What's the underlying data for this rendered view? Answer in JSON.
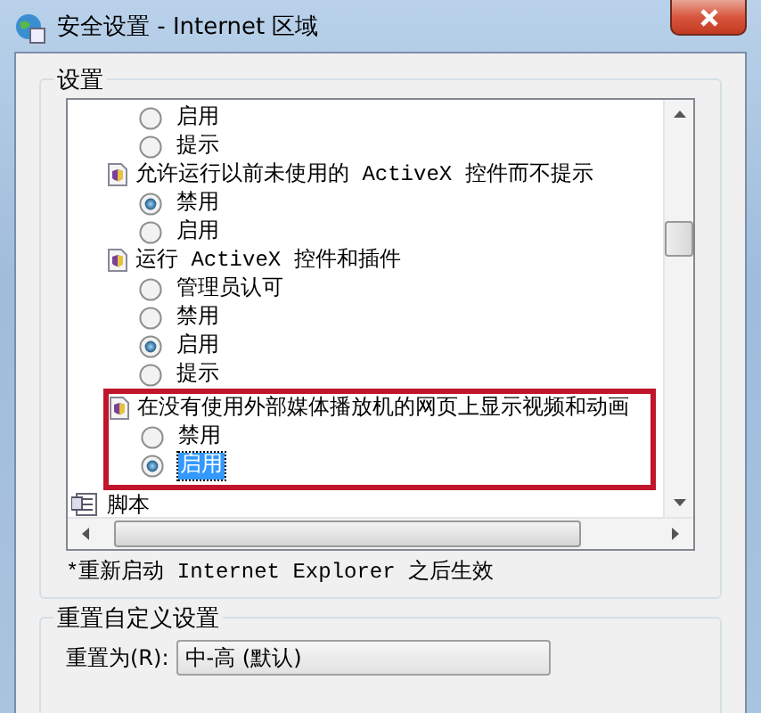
{
  "window": {
    "title": "安全设置 - Internet 区域"
  },
  "settings_group": {
    "title": "设置",
    "items": [
      {
        "options": [
          {
            "label": "启用",
            "selected": false,
            "focused": false
          },
          {
            "label": "提示",
            "selected": false,
            "focused": false
          }
        ],
        "highlighted": false
      },
      {
        "label": "允许运行以前未使用的 ActiveX 控件而不提示",
        "options": [
          {
            "label": "禁用",
            "selected": true,
            "focused": false
          },
          {
            "label": "启用",
            "selected": false,
            "focused": false
          }
        ],
        "highlighted": false
      },
      {
        "label": "运行 ActiveX 控件和插件",
        "options": [
          {
            "label": "管理员认可",
            "selected": false,
            "focused": false
          },
          {
            "label": "禁用",
            "selected": false,
            "focused": false
          },
          {
            "label": "启用",
            "selected": true,
            "focused": false
          },
          {
            "label": "提示",
            "selected": false,
            "focused": false
          }
        ],
        "highlighted": false
      },
      {
        "label": "在没有使用外部媒体播放机的网页上显示视频和动画",
        "options": [
          {
            "label": "禁用",
            "selected": false,
            "focused": false
          },
          {
            "label": "启用",
            "selected": true,
            "focused": true
          }
        ],
        "highlighted": true
      },
      {
        "label": "脚本",
        "kind": "category",
        "highlighted": false
      }
    ],
    "note": "*重新启动 Internet Explorer 之后生效"
  },
  "reset_group": {
    "title": "重置自定义设置",
    "label": "重置为(R):",
    "value": "中-高 (默认)"
  }
}
